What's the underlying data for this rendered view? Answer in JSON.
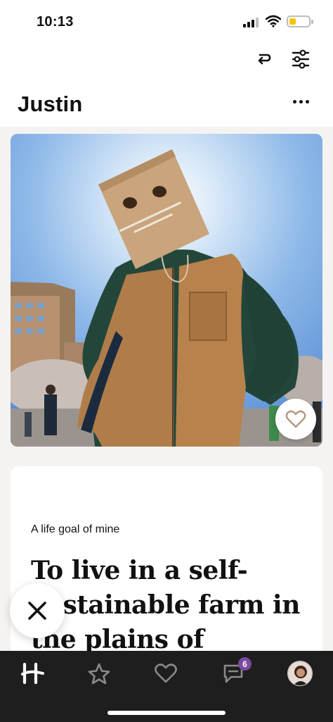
{
  "status_bar": {
    "time": "10:13"
  },
  "profile": {
    "name": "Justin"
  },
  "prompt": {
    "question": "A life goal of mine",
    "answer": "To live in a self-sustainable farm in the plains of"
  },
  "nav": {
    "matches_badge": "6"
  },
  "colors": {
    "tab_bar": "#1e1e1e",
    "badge": "#7b4a9e",
    "battery": "#f5c400",
    "background": "#f4f3f2"
  },
  "icons": {
    "undo": "undo-arrow-icon",
    "filter": "sliders-filter-icon",
    "more": "ellipsis-icon",
    "like": "heart-icon",
    "skip": "x-close-icon",
    "home": "hinge-logo-icon",
    "standouts": "star-icon",
    "likes": "heart-icon",
    "matches": "chat-bubble-icon",
    "profile": "avatar"
  }
}
